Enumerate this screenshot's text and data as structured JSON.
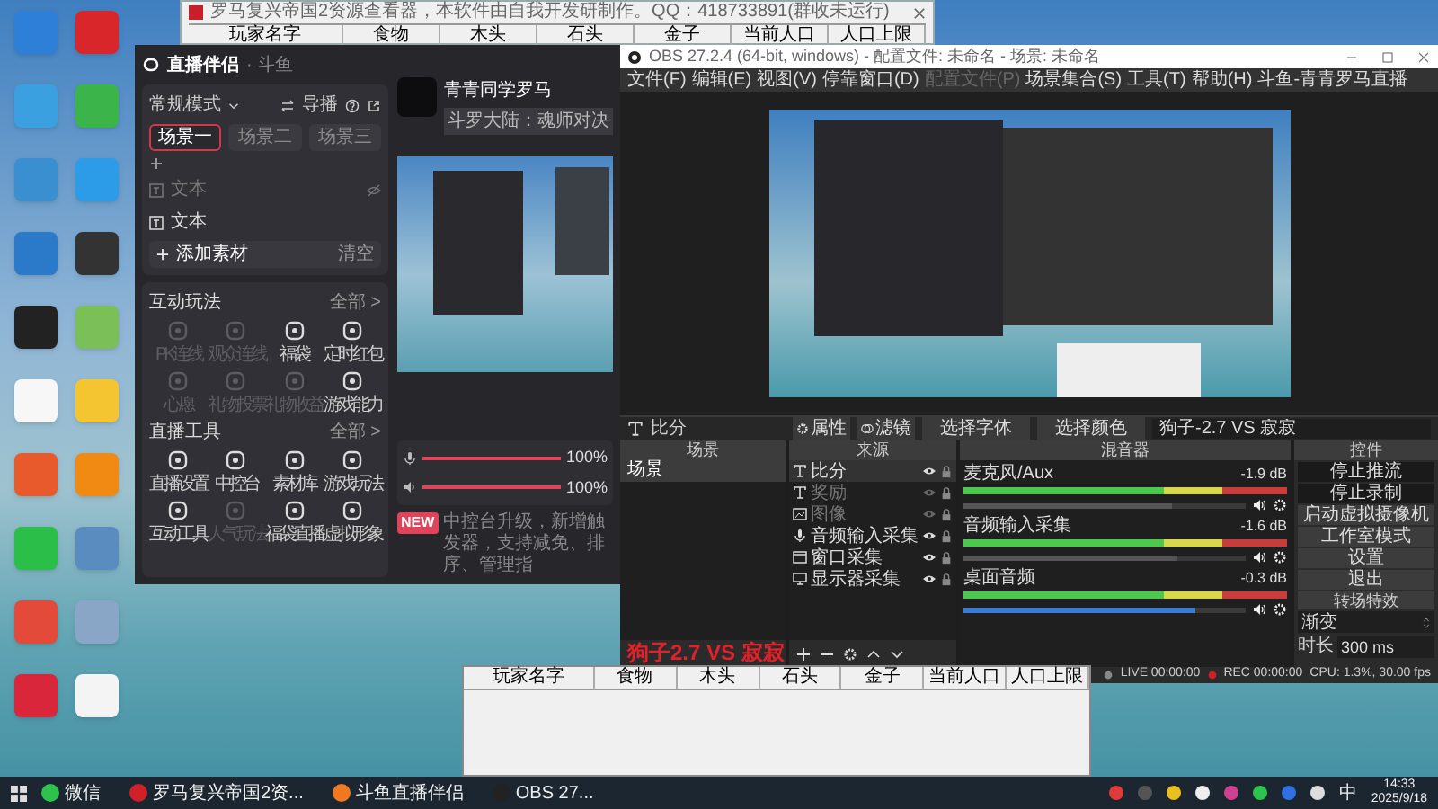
{
  "game_window": {
    "title": "罗马复兴帝国2资源查看器，本软件由自我开发研制作。QQ：418733891(群收未运行)",
    "columns": [
      "玩家名字",
      "食物",
      "木头",
      "石头",
      "金子",
      "当前人口",
      "人口上限"
    ]
  },
  "companion": {
    "app_name": "直播伴侣",
    "platform": "· 斗鱼",
    "mode": "常规模式",
    "guide": "导播",
    "scenes": [
      {
        "label": "场景一",
        "selected": true
      },
      {
        "label": "场景二",
        "selected": false
      },
      {
        "label": "场景三",
        "selected": false
      }
    ],
    "materials": [
      {
        "label": "文本",
        "hidden": true
      },
      {
        "label": "文本",
        "hidden": false
      }
    ],
    "add_material": "添加素材",
    "clear": "清空",
    "sections": [
      {
        "title": "互动玩法",
        "more": "全部 >",
        "items": [
          {
            "label": "PK连线",
            "disabled": true
          },
          {
            "label": "观众连线",
            "disabled": true
          },
          {
            "label": "福袋",
            "disabled": false
          },
          {
            "label": "定时红包",
            "disabled": false
          },
          {
            "label": "心愿",
            "disabled": true
          },
          {
            "label": "礼物投票",
            "disabled": true
          },
          {
            "label": "礼物收益",
            "disabled": true
          },
          {
            "label": "游戏能力",
            "disabled": false
          }
        ]
      },
      {
        "title": "直播工具",
        "more": "全部 >",
        "items": [
          {
            "label": "直播设置",
            "disabled": false
          },
          {
            "label": "中控台",
            "disabled": false
          },
          {
            "label": "素材库",
            "disabled": false
          },
          {
            "label": "游戏玩法",
            "disabled": false
          },
          {
            "label": "互动工具",
            "disabled": false
          },
          {
            "label": "人气玩法",
            "disabled": true
          },
          {
            "label": "福袋直播",
            "disabled": false
          },
          {
            "label": "虚拟形象",
            "disabled": false
          }
        ]
      }
    ],
    "streamer": "青青同学罗马",
    "category": "斗罗大陆：魂师对决",
    "volumes": [
      {
        "kind": "mic",
        "level": 1,
        "reading": "100%"
      },
      {
        "kind": "speaker",
        "level": 1,
        "reading": "100%"
      }
    ],
    "notice_badge": "NEW",
    "notice": "中控台升级，新增触发器，支持减免、排序、管理指"
  },
  "obs": {
    "title": "OBS 27.2.4 (64-bit, windows) - 配置文件: 未命名 - 场景: 未命名",
    "menu": [
      {
        "label": "文件(F)",
        "disabled": false
      },
      {
        "label": "编辑(E)",
        "disabled": false
      },
      {
        "label": "视图(V)",
        "disabled": false
      },
      {
        "label": "停靠窗口(D)",
        "disabled": false
      },
      {
        "label": "配置文件(P)",
        "disabled": true
      },
      {
        "label": "场景集合(S)",
        "disabled": false
      },
      {
        "label": "工具(T)",
        "disabled": false
      },
      {
        "label": "帮助(H)",
        "disabled": false
      },
      {
        "label": "斗鱼-青青罗马直播",
        "disabled": false
      }
    ],
    "source_toolbar": {
      "source": "比分",
      "properties": "属性",
      "filters": "滤镜",
      "font_button": "选择字体",
      "color_button": "选择颜色",
      "text_value": "狗子-2.7 VS 寂寂"
    },
    "scenes_title": "场景",
    "scenes": [
      {
        "label": "场景",
        "selected": true
      }
    ],
    "overlay_text": "狗子2.7 VS 寂寂",
    "sources_title": "来源",
    "sources": [
      {
        "kind": "text",
        "name": "比分",
        "visible": true
      },
      {
        "kind": "text",
        "name": "奖励",
        "visible": false
      },
      {
        "kind": "image",
        "name": "图像",
        "visible": false
      },
      {
        "kind": "mic",
        "name": "音频输入采集",
        "visible": true
      },
      {
        "kind": "window",
        "name": "窗口采集",
        "visible": true
      },
      {
        "kind": "monitor",
        "name": "显示器采集",
        "visible": true
      }
    ],
    "mixer_title": "混音器",
    "channels": [
      {
        "name": "麦克风/Aux",
        "reading": "-1.9 dB",
        "level": 0.74,
        "kind": "gray"
      },
      {
        "name": "音频输入采集",
        "reading": "-1.6 dB",
        "level": 0.76,
        "kind": "gray"
      },
      {
        "name": "桌面音频",
        "reading": "-0.3 dB",
        "level": 0.82,
        "kind": "blue"
      }
    ],
    "controls_title": "控件",
    "controls": [
      {
        "label": "停止推流",
        "active": true
      },
      {
        "label": "停止录制",
        "active": true
      },
      {
        "label": "启动虚拟摄像机",
        "active": false
      },
      {
        "label": "工作室模式",
        "active": false
      },
      {
        "label": "设置",
        "active": false
      },
      {
        "label": "退出",
        "active": false
      }
    ],
    "transitions_title": "转场特效",
    "transition": "渐变",
    "duration_label": "时长",
    "duration": "300 ms",
    "status": [
      {
        "kind": "live",
        "text": "LIVE 00:00:00"
      },
      {
        "kind": "rec",
        "text": "REC 00:00:00"
      },
      {
        "kind": "plain",
        "text": "CPU: 1.3%, 30.00 fps"
      }
    ]
  },
  "table_window": {
    "columns": [
      "玩家名字",
      "食物",
      "木头",
      "石头",
      "金子",
      "当前人口",
      "人口上限"
    ]
  },
  "taskbar": {
    "apps": [
      {
        "kind": "wechat",
        "label": "微信"
      },
      {
        "kind": "game",
        "label": "罗马复兴帝国2资..."
      },
      {
        "kind": "douyu",
        "label": "斗鱼直播伴侣"
      },
      {
        "kind": "obs",
        "label": "OBS 27..."
      }
    ],
    "ime": "中",
    "time": "14:33",
    "date": "2025/9/18"
  }
}
